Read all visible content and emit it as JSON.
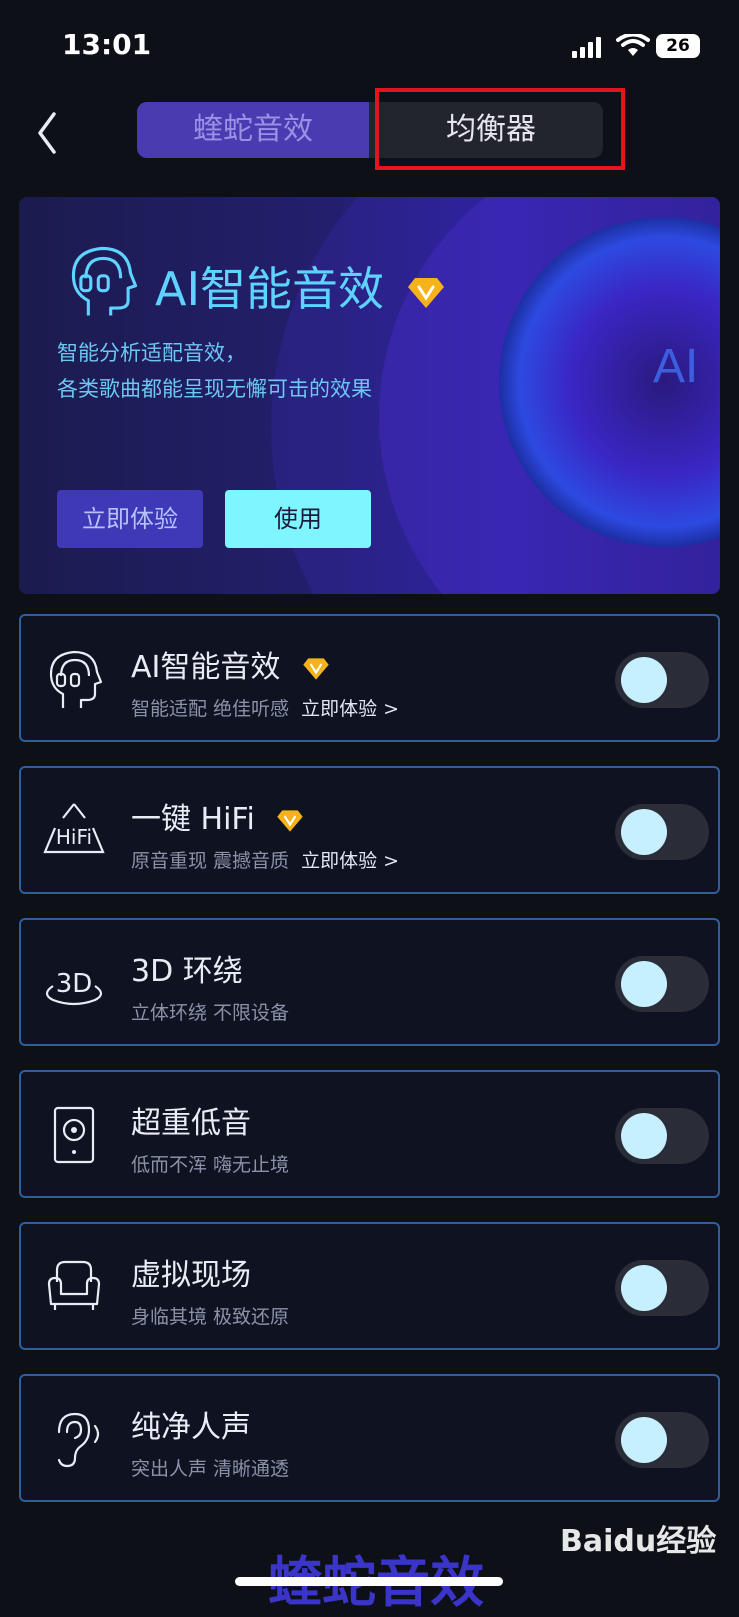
{
  "status_bar": {
    "time": "13:01",
    "battery": "26"
  },
  "tabs": [
    {
      "label": "蝰蛇音效"
    },
    {
      "label": "均衡器"
    }
  ],
  "banner": {
    "title": "AI智能音效",
    "subtitle_line1": "智能分析适配音效，",
    "subtitle_line2": "各类歌曲都能呈现无懈可击的效果",
    "orb_text": "AI",
    "try_label": "立即体验",
    "use_label": "使用"
  },
  "effects": [
    {
      "title": "AI智能音效",
      "subtitle": "智能适配 绝佳听感",
      "link": "立即体验 >",
      "vip": true,
      "icon": "ai-head-icon",
      "enabled": false
    },
    {
      "title": "一键 HiFi",
      "subtitle": "原音重现 震撼音质",
      "link": "立即体验 >",
      "vip": true,
      "icon": "hifi-icon",
      "enabled": false
    },
    {
      "title": "3D 环绕",
      "subtitle": "立体环绕 不限设备",
      "link": "",
      "vip": false,
      "icon": "3d-surround-icon",
      "enabled": false
    },
    {
      "title": "超重低音",
      "subtitle": "低而不浑 嗨无止境",
      "link": "",
      "vip": false,
      "icon": "speaker-icon",
      "enabled": false
    },
    {
      "title": "虚拟现场",
      "subtitle": "身临其境 极致还原",
      "link": "",
      "vip": false,
      "icon": "sofa-icon",
      "enabled": false
    },
    {
      "title": "纯净人声",
      "subtitle": "突出人声 清晰通透",
      "link": "",
      "vip": false,
      "icon": "ear-icon",
      "enabled": false
    }
  ],
  "bottom_title": "蝰蛇音效",
  "watermark": "Baidu经验"
}
